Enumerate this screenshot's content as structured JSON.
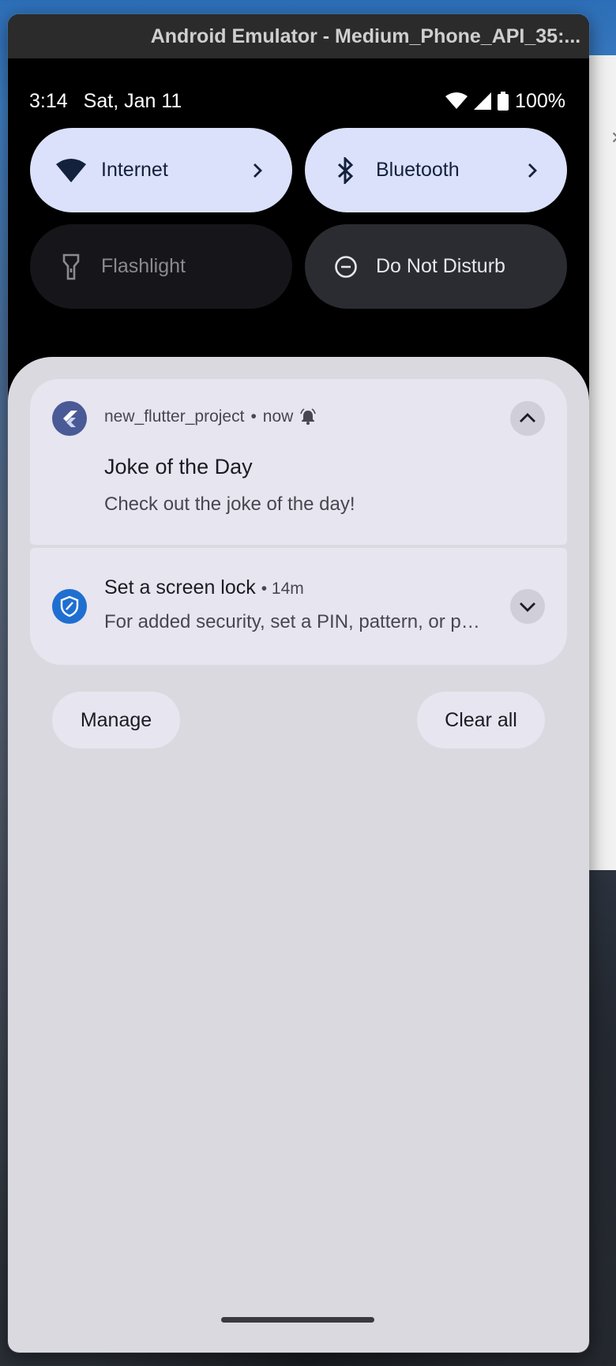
{
  "emulator": {
    "title": "Android Emulator - Medium_Phone_API_35:..."
  },
  "status_bar": {
    "time": "3:14",
    "date": "Sat, Jan 11",
    "battery": "100%",
    "icons": [
      "wifi-icon",
      "cellular-signal-icon",
      "battery-icon"
    ]
  },
  "quick_settings": [
    {
      "label": "Internet",
      "icon": "wifi-icon",
      "state": "on"
    },
    {
      "label": "Bluetooth",
      "icon": "bluetooth-icon",
      "state": "on"
    },
    {
      "label": "Flashlight",
      "icon": "flashlight-icon",
      "state": "off"
    },
    {
      "label": "Do Not Disturb",
      "icon": "do-not-disturb-icon",
      "state": "off"
    }
  ],
  "notifications": [
    {
      "app": "new_flutter_project",
      "time": "now",
      "title": "Joke of the Day",
      "body": "Check out the joke of the day!",
      "expanded": true
    },
    {
      "title": "Set a screen lock",
      "time": "14m",
      "body": "For added security, set a PIN, pattern, or password",
      "expanded": false
    }
  ],
  "actions": {
    "manage": "Manage",
    "clear_all": "Clear all"
  },
  "colors": {
    "tile_on": "#dbe1fa",
    "tile_off": "#16161a",
    "shade": "#dad9e0",
    "notification_bg": "#e7e5ef",
    "flutter_icon": "#4a5a96",
    "security_icon": "#1f6fd1"
  }
}
